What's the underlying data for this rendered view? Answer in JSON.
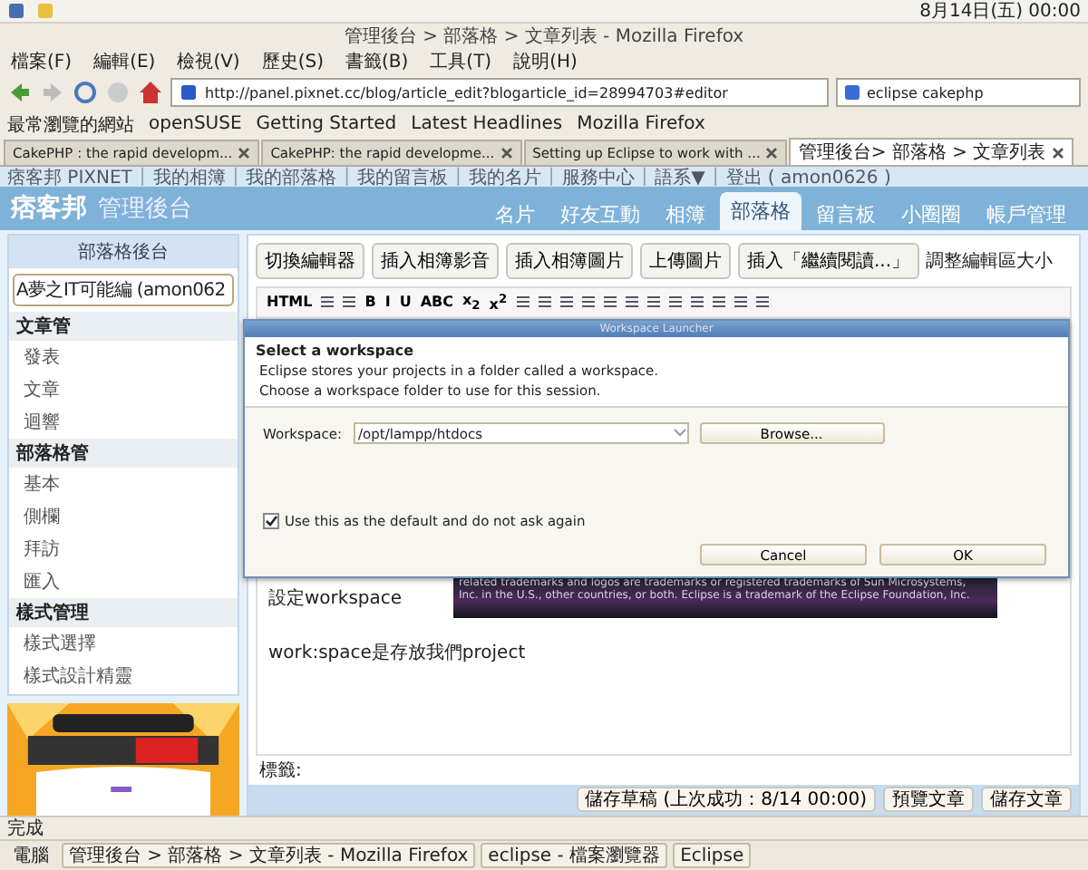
{
  "top_panel": {
    "clock": "8月14日(五) 00:00"
  },
  "window": {
    "title": "管理後台 > 部落格 > 文章列表 - Mozilla Firefox"
  },
  "menu": [
    "檔案(F)",
    "編輯(E)",
    "檢視(V)",
    "歷史(S)",
    "書籤(B)",
    "工具(T)",
    "說明(H)"
  ],
  "address": {
    "url": "http://panel.pixnet.cc/blog/article_edit?blogarticle_id=28994703#editor",
    "search": "eclipse cakephp"
  },
  "bookmarks": [
    "最常瀏覽的網站",
    "openSUSE",
    "Getting Started",
    "Latest Headlines",
    "Mozilla Firefox"
  ],
  "tabs": [
    {
      "label": "CakePHP : the rapid developm...",
      "selected": false
    },
    {
      "label": "CakePHP: the rapid developme...",
      "selected": false
    },
    {
      "label": "Setting up Eclipse to work with ...",
      "selected": false
    },
    {
      "label": "管理後台> 部落格 > 文章列表",
      "selected": true
    }
  ],
  "site_links_separator": "|",
  "site_links": [
    "痞客邦 PIXNET",
    "我的相簿",
    "我的部落格",
    "我的留言板",
    "我的名片",
    "服務中心",
    "語系▼",
    "登出 ( amon0626 )"
  ],
  "site_header": {
    "logo": "痞客邦",
    "title": "管理後台",
    "nav": [
      {
        "label": "名片",
        "selected": false
      },
      {
        "label": "好友互動",
        "selected": false
      },
      {
        "label": "相簿",
        "selected": false
      },
      {
        "label": "部落格",
        "selected": true
      },
      {
        "label": "留言板",
        "selected": false
      },
      {
        "label": "小圈圈",
        "selected": false
      },
      {
        "label": "帳戶管理",
        "selected": false
      }
    ]
  },
  "sidebar": {
    "title": "部落格後台",
    "blog_select": "A夢之IT可能編 (amon062",
    "sections": [
      {
        "title": "文章管",
        "items": [
          "發表",
          "文章",
          "迴響"
        ]
      },
      {
        "title": "部落格管",
        "items": [
          "基本",
          "側欄",
          "拜訪",
          "匯入"
        ]
      },
      {
        "title": "樣式管理",
        "items": [
          "樣式選擇",
          "樣式設計精靈"
        ]
      }
    ]
  },
  "editor": {
    "buttons": [
      "切換編輯器",
      "插入相簿影音",
      "插入相簿圖片",
      "上傳圖片",
      "插入「繼續閱讀...」"
    ],
    "resize_label": "調整編輯區大小",
    "format_tools": [
      {
        "kind": "text",
        "label": "HTML"
      },
      {
        "kind": "icon"
      },
      {
        "kind": "icon"
      },
      {
        "kind": "text",
        "label": "B"
      },
      {
        "kind": "text",
        "label": "I"
      },
      {
        "kind": "text",
        "label": "U"
      },
      {
        "kind": "text",
        "label": "ABC"
      },
      {
        "kind": "text",
        "label": "x$_{2}$"
      },
      {
        "kind": "text",
        "label": "x$^{2}$"
      },
      {
        "kind": "icon"
      },
      {
        "kind": "icon"
      },
      {
        "kind": "icon"
      },
      {
        "kind": "icon"
      },
      {
        "kind": "icon"
      },
      {
        "kind": "icon"
      },
      {
        "kind": "icon"
      },
      {
        "kind": "icon"
      },
      {
        "kind": "icon"
      },
      {
        "kind": "icon"
      },
      {
        "kind": "icon"
      },
      {
        "kind": "icon"
      }
    ],
    "content": [
      "設定workspace",
      "work:space是存放我們project"
    ],
    "tags_label": "標籤:",
    "actions": [
      "儲存草稿 (上次成功：8/14 00:00)",
      "預覽文章",
      "儲存文章"
    ]
  },
  "splash": [
    "related trademarks and logos are trademarks or registered trademarks of Sun Microsystems,",
    "Inc. in the U.S., other countries, or both. Eclipse is a trademark of the Eclipse Foundation, Inc."
  ],
  "dialog": {
    "title": "Workspace Launcher",
    "heading": "Select a workspace",
    "description": [
      "Eclipse stores your projects in a folder called a workspace.",
      "Choose a workspace folder to use for this session."
    ],
    "field_label": "Workspace:",
    "field_value": "/opt/lampp/htdocs",
    "browse": "Browse...",
    "default_checkbox": {
      "label": "Use this as the default and do not ask again",
      "checked": true
    },
    "buttons": [
      "Cancel",
      "OK"
    ]
  },
  "status": "完成",
  "taskbar": {
    "start": "電腦",
    "tasks": [
      "管理後台 > 部落格 > 文章列表 - Mozilla Firefox",
      "eclipse - 檔案瀏覽器",
      "Eclipse"
    ]
  }
}
